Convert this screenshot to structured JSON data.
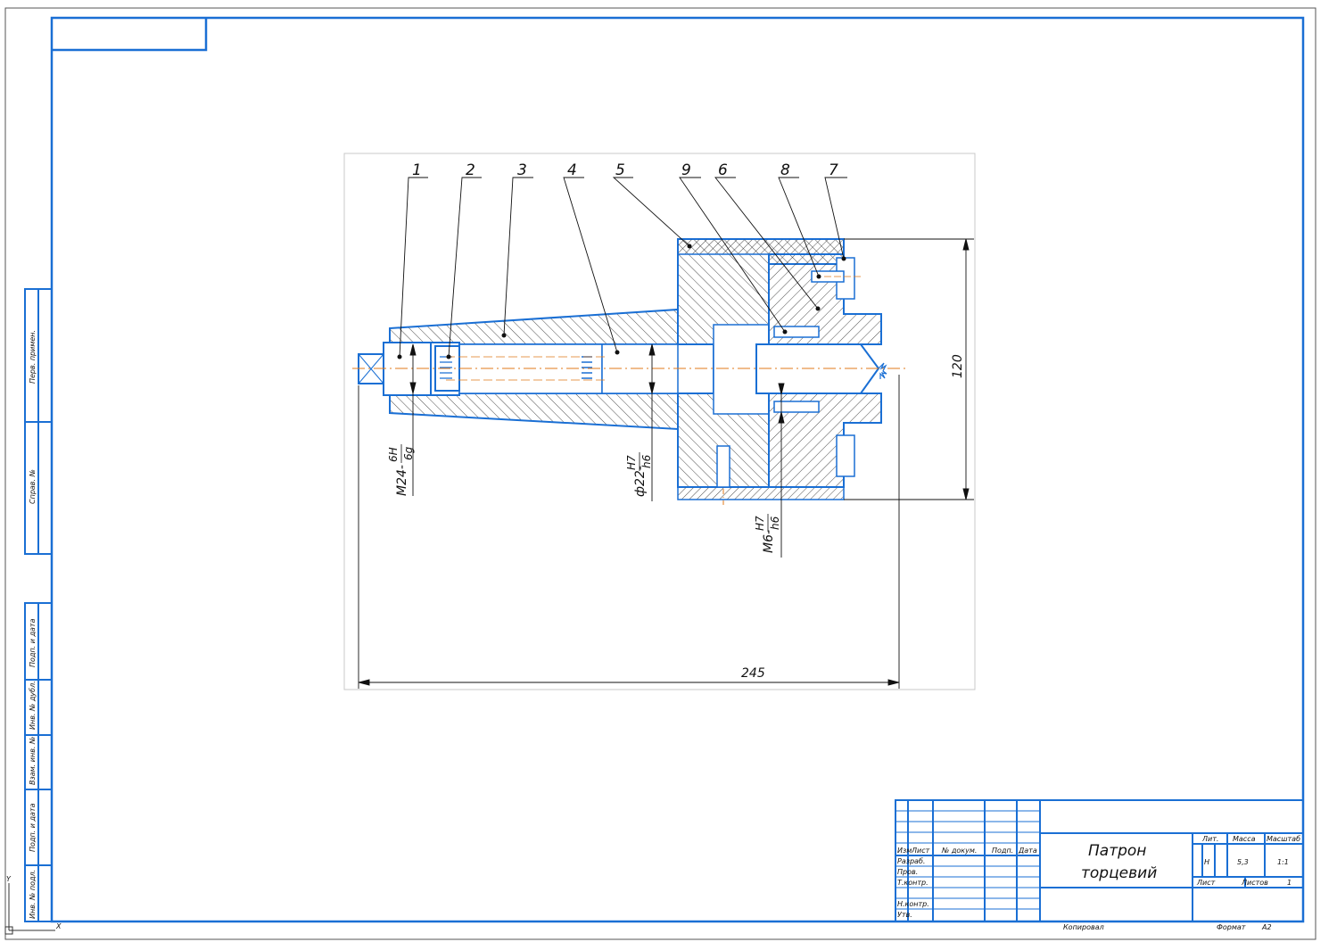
{
  "colors": {
    "frame": "#1a6fd4",
    "hatch": "#222222",
    "axis": "#e07a1a",
    "dim": "#111111",
    "viewport_border": "#c8c8c8"
  },
  "callouts": [
    "1",
    "2",
    "3",
    "4",
    "5",
    "9",
    "6",
    "8",
    "7"
  ],
  "dimensions": {
    "overall_length": "245",
    "height": "120",
    "fit_thread": "M24-",
    "fit_thread_num": "6H",
    "fit_thread_den": "6g",
    "fit_shaft": "ф22-",
    "fit_shaft_num": "H7",
    "fit_shaft_den": "h6",
    "fit_pin": "M6-",
    "fit_pin_num": "H7",
    "fit_pin_den": "h6"
  },
  "side_stamp": {
    "top": [
      "Перв. примен.",
      "Справ. №"
    ],
    "bottom": [
      "Подп. и дата",
      "Инв. № дубл.",
      "Взам. инв. №",
      "Подп. и дата",
      "Инв. № подл."
    ]
  },
  "title_block": {
    "title_line1": "Патрон",
    "title_line2": "торцевий",
    "header_cols": [
      "Изм",
      "Лист",
      "№ докум.",
      "Подп.",
      "Дата"
    ],
    "row_labels": [
      "Разраб.",
      "Пров.",
      "Т.контр.",
      "",
      "Н.контр.",
      "Утв."
    ],
    "lit_label": "Лит.",
    "mass_label": "Масса",
    "scale_label": "Масштаб",
    "lit_value": "Н",
    "mass_value": "5,3",
    "scale_value": "1:1",
    "sheet_label": "Лист",
    "sheets_label": "Листов",
    "sheets_value": "1",
    "copied_label": "Копировал",
    "format_label": "Формат",
    "format_value": "А2"
  },
  "axis_marks": {
    "y": "Y",
    "x": "X"
  }
}
